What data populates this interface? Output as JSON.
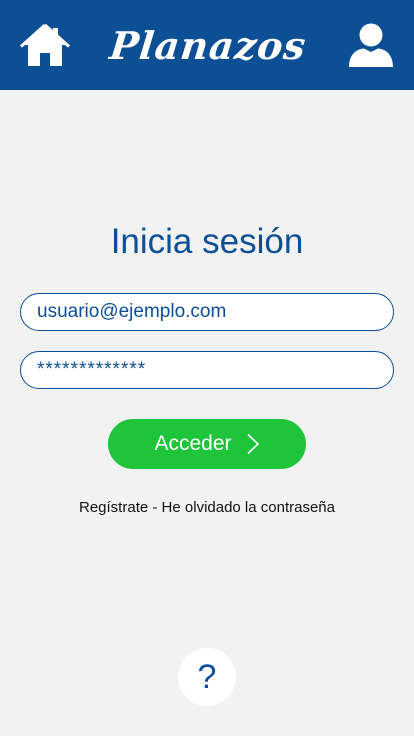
{
  "header": {
    "home_icon": "home-icon",
    "app_title": "Planazos",
    "user_icon": "user-icon"
  },
  "login": {
    "title": "Inicia sesión",
    "email_value": "usuario@ejemplo.com",
    "password_value": "*************",
    "submit_label": "Acceder",
    "submit_icon": "chevron-right-icon",
    "register_link": "Regístrate",
    "separator": " - ",
    "forgot_link": "He olvidado la contraseña"
  },
  "help": {
    "label": "?"
  },
  "colors": {
    "brand_blue": "#0d4f95",
    "accent_green": "#1ec43a",
    "background": "#f2f2f2"
  }
}
